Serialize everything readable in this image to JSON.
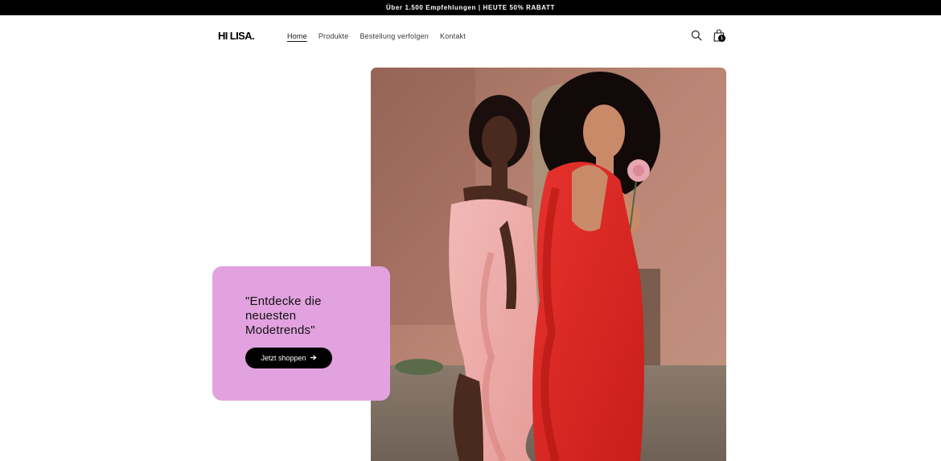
{
  "announcement": {
    "text": "Über 1.500 Empfehlungen | HEUTE 50% RABATT"
  },
  "header": {
    "logo": "HI LISA.",
    "nav": [
      {
        "label": "Home",
        "active": true
      },
      {
        "label": "Produkte",
        "active": false
      },
      {
        "label": "Bestellung verfolgen",
        "active": false
      },
      {
        "label": "Kontakt",
        "active": false
      }
    ],
    "icons": {
      "search": "search-icon",
      "cart": "shopping-bag-icon"
    },
    "cart_count": "1"
  },
  "hero": {
    "heading": "\"Entdecke die neuesten Modetrends\"",
    "button_label": "Jetzt shoppen",
    "button_icon": "arrow-right-icon",
    "image_icon": "two-women-in-dresses-photo"
  },
  "colors": {
    "announcement_bg": "#000000",
    "promo_bg": "#e2a2df",
    "button_bg": "#000000",
    "page_bg": "#ffffff"
  }
}
